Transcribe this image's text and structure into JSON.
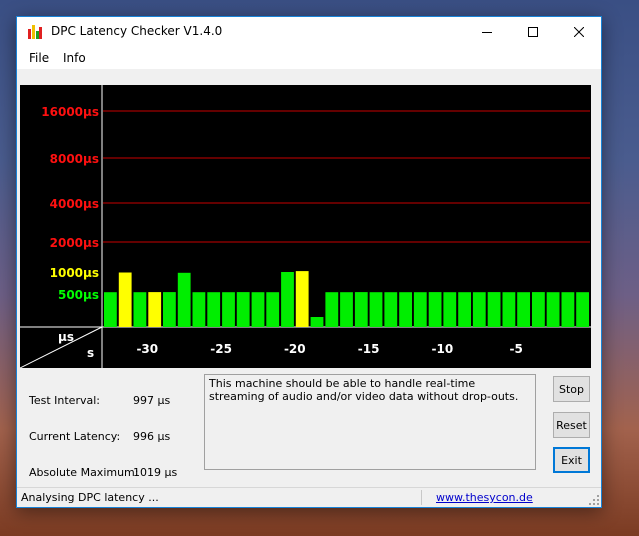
{
  "window": {
    "title": "DPC Latency Checker V1.4.0"
  },
  "menu": [
    {
      "label": "File"
    },
    {
      "label": "Info"
    }
  ],
  "chart_data": {
    "type": "bar",
    "ylabels": [
      "16000µs",
      "8000µs",
      "4000µs",
      "2000µs",
      "1000µs",
      "500µs"
    ],
    "ylabel_colors": [
      "#ff1010",
      "#ff1010",
      "#ff1010",
      "#ff1010",
      "#ffff00",
      "#00ff00"
    ],
    "xlabels": [
      "-30",
      "-25",
      "-20",
      "-15",
      "-10",
      "-5"
    ],
    "xticks": [
      -30,
      -25,
      -20,
      -15,
      -10,
      -5
    ],
    "corner_y_unit": "µs",
    "corner_x_unit": "s",
    "xlim": [
      -33,
      0
    ],
    "unit_us": "µs",
    "values_us": [
      996,
      1005,
      997,
      998,
      998,
      1002,
      997,
      996,
      997,
      998,
      996,
      997,
      1010,
      1019,
      500,
      996,
      997,
      998,
      997,
      996,
      997,
      996,
      998,
      997,
      996,
      997,
      998,
      996,
      997,
      998,
      997,
      996,
      997
    ],
    "bar_colors": [
      "#00ee00",
      "#ffff00",
      "#00ee00",
      "#ffff00",
      "#00ee00",
      "#00ee00",
      "#00ee00",
      "#00ee00",
      "#00ee00",
      "#00ee00",
      "#00ee00",
      "#00ee00",
      "#00ee00",
      "#ffff00",
      "#00ee00",
      "#00ee00",
      "#00ee00",
      "#00ee00",
      "#00ee00",
      "#00ee00",
      "#00ee00",
      "#00ee00",
      "#00ee00",
      "#00ee00",
      "#00ee00",
      "#00ee00",
      "#00ee00",
      "#00ee00",
      "#00ee00",
      "#00ee00",
      "#00ee00",
      "#00ee00",
      "#00ee00"
    ]
  },
  "info": {
    "test_interval_label": "Test Interval:",
    "test_interval_value": "997 µs",
    "current_latency_label": "Current Latency:",
    "current_latency_value": "996 µs",
    "absolute_maximum_label": "Absolute Maximum:",
    "absolute_maximum_value": "1019 µs"
  },
  "message": "This machine should be able to handle real-time streaming of audio and/or video data without drop-outs.",
  "buttons": {
    "stop": "Stop",
    "reset": "Reset",
    "exit": "Exit"
  },
  "status": {
    "text": "Analysing DPC latency ...",
    "link": "www.thesycon.de"
  },
  "colors": {
    "accent": "#1883d7",
    "grid_red": "#c80000",
    "bar_green": "#00ee00",
    "bar_yellow": "#ffff00"
  }
}
